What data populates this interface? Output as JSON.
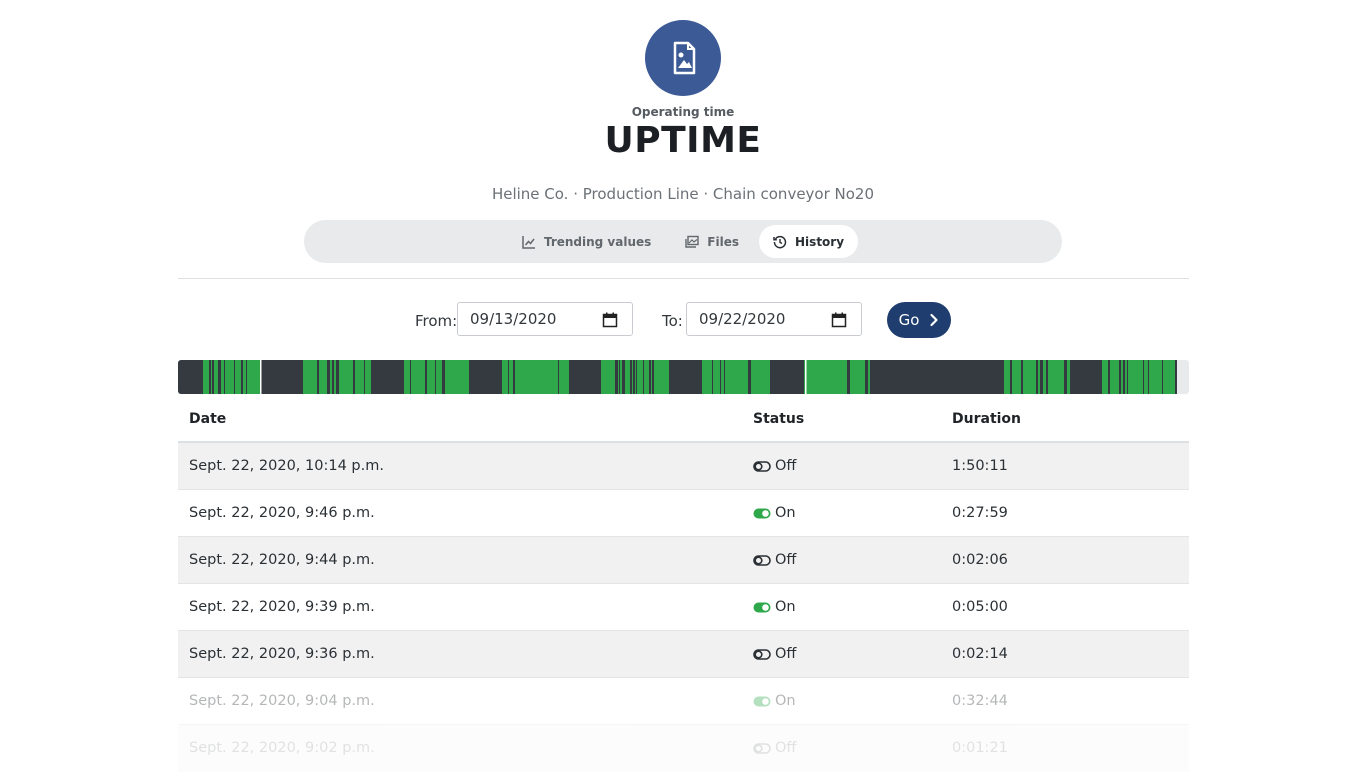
{
  "header": {
    "subtitle": "Operating time",
    "title": "UPTIME",
    "breadcrumb": "Heline Co. · Production Line · Chain conveyor No20",
    "logo_icon": "image-file-icon",
    "logo_color": "#3c5a96"
  },
  "tabs": [
    {
      "label": "Trending values",
      "icon": "chart-line-icon",
      "active": false
    },
    {
      "label": "Files",
      "icon": "images-icon",
      "active": false
    },
    {
      "label": "History",
      "icon": "history-icon",
      "active": true
    }
  ],
  "filters": {
    "from_label": "From:",
    "from_value": "09/13/2020",
    "to_label": "To:",
    "to_value": "09/22/2020",
    "go_label": "Go"
  },
  "timeline": {
    "on_color": "#2ea84a",
    "off_color": "#343a40"
  },
  "table": {
    "headers": [
      "Date",
      "Status",
      "Duration"
    ],
    "rows": [
      {
        "date": "Sept. 22, 2020, 10:14 p.m.",
        "status": "Off",
        "duration": "1:50:11"
      },
      {
        "date": "Sept. 22, 2020, 9:46 p.m.",
        "status": "On",
        "duration": "0:27:59"
      },
      {
        "date": "Sept. 22, 2020, 9:44 p.m.",
        "status": "Off",
        "duration": "0:02:06"
      },
      {
        "date": "Sept. 22, 2020, 9:39 p.m.",
        "status": "On",
        "duration": "0:05:00"
      },
      {
        "date": "Sept. 22, 2020, 9:36 p.m.",
        "status": "Off",
        "duration": "0:02:14"
      },
      {
        "date": "Sept. 22, 2020, 9:04 p.m.",
        "status": "On",
        "duration": "0:32:44"
      },
      {
        "date": "Sept. 22, 2020, 9:02 p.m.",
        "status": "Off",
        "duration": "0:01:21"
      }
    ]
  }
}
